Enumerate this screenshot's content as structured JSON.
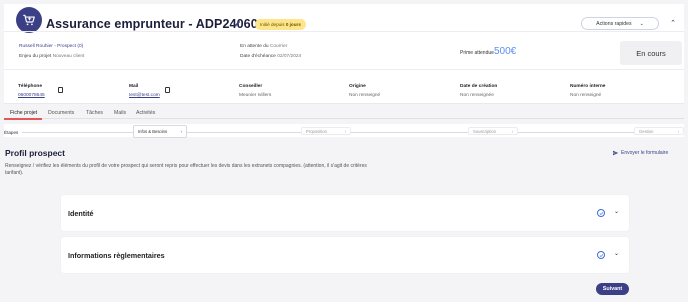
{
  "header": {
    "title": "Assurance emprunteur - ADP240608143",
    "since_prefix": "Initié depuis",
    "since_value": "0 jours",
    "quick_actions": "Actions rapides",
    "prospect": "Russell Rouhier - Prospect (0)",
    "project_label": "Enjeu du projet",
    "project_value": "Nouveau client",
    "waiting_label": "En attente du",
    "waiting_value": "Courrier",
    "deadline_label": "Date d'échéance",
    "deadline_value": "02/07/2024",
    "prime_label": "Prime attendue",
    "prime_value": "500€",
    "status": "En cours"
  },
  "info": {
    "phone_label": "Téléphone",
    "phone_value": "0600078645",
    "mail_label": "Mail",
    "mail_value": "test@test.com",
    "advisor_label": "Conseiller",
    "advisor_value": "Meunier Ivillers",
    "origin_label": "Origine",
    "origin_value": "Non renseigné",
    "created_label": "Date de création",
    "created_value": "Non renseignée",
    "internal_label": "Numéro interne",
    "internal_value": "Non renseigné"
  },
  "tabs": [
    "Fiche projet",
    "Documents",
    "Tâches",
    "Mails",
    "Activités"
  ],
  "steps": {
    "label": "Étapes",
    "items": [
      "Infos & Besoins",
      "Proposition",
      "Souscription",
      "Gestion"
    ]
  },
  "profile": {
    "title": "Profil prospect",
    "send_form": "Envoyer le formulaire",
    "description": "Renseignez / vérifiez les éléments du profil de votre prospect qui seront repris pour effectuer les devis dans les extranets compagnies. (attention, il s'agit de critères tarifant)."
  },
  "cards": [
    {
      "title": "Identité"
    },
    {
      "title": "Informations règlementaires"
    }
  ],
  "next_button": "Suivant",
  "colors": {
    "brand": "#3b3f86",
    "accent_tab": "#e0585a",
    "badge_bg": "#fde68a",
    "prime": "#5b8def"
  }
}
